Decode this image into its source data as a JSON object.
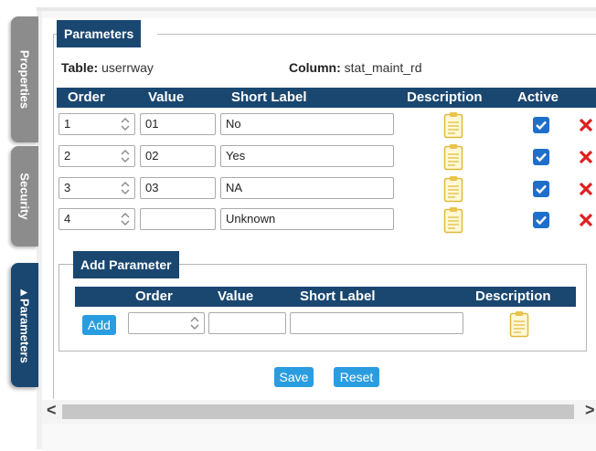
{
  "tabs": [
    {
      "label": "Properties",
      "active": false
    },
    {
      "label": "Security",
      "active": false
    },
    {
      "label": "▲Parameters",
      "active": true
    }
  ],
  "panel": {
    "title": "Parameters",
    "table_label": "Table:",
    "table_value": "userrway",
    "column_label": "Column:",
    "column_value": "stat_maint_rd"
  },
  "grid": {
    "headers": {
      "order": "Order",
      "value": "Value",
      "short_label": "Short Label",
      "description": "Description",
      "active": "Active"
    },
    "rows": [
      {
        "order": "1",
        "value": "01",
        "short_label": "No",
        "active": true
      },
      {
        "order": "2",
        "value": "02",
        "short_label": "Yes",
        "active": true
      },
      {
        "order": "3",
        "value": "03",
        "short_label": "NA",
        "active": true
      },
      {
        "order": "4",
        "value": "",
        "short_label": "Unknown",
        "active": true
      }
    ]
  },
  "add_parameter": {
    "title": "Add Parameter",
    "headers": {
      "order": "Order",
      "value": "Value",
      "short_label": "Short Label",
      "description": "Description"
    },
    "add_label": "Add",
    "order_value": "",
    "value_value": "",
    "short_label_value": ""
  },
  "footer": {
    "save_label": "Save",
    "reset_label": "Reset"
  },
  "scrollbar": {
    "left_arrow": "<",
    "right_arrow": ">"
  },
  "colors": {
    "header_bg": "#1a4770",
    "button": "#2a9de0",
    "checkbox": "#1d6fc9",
    "delete": "#e02020",
    "clipboard": "#e9c44a"
  }
}
